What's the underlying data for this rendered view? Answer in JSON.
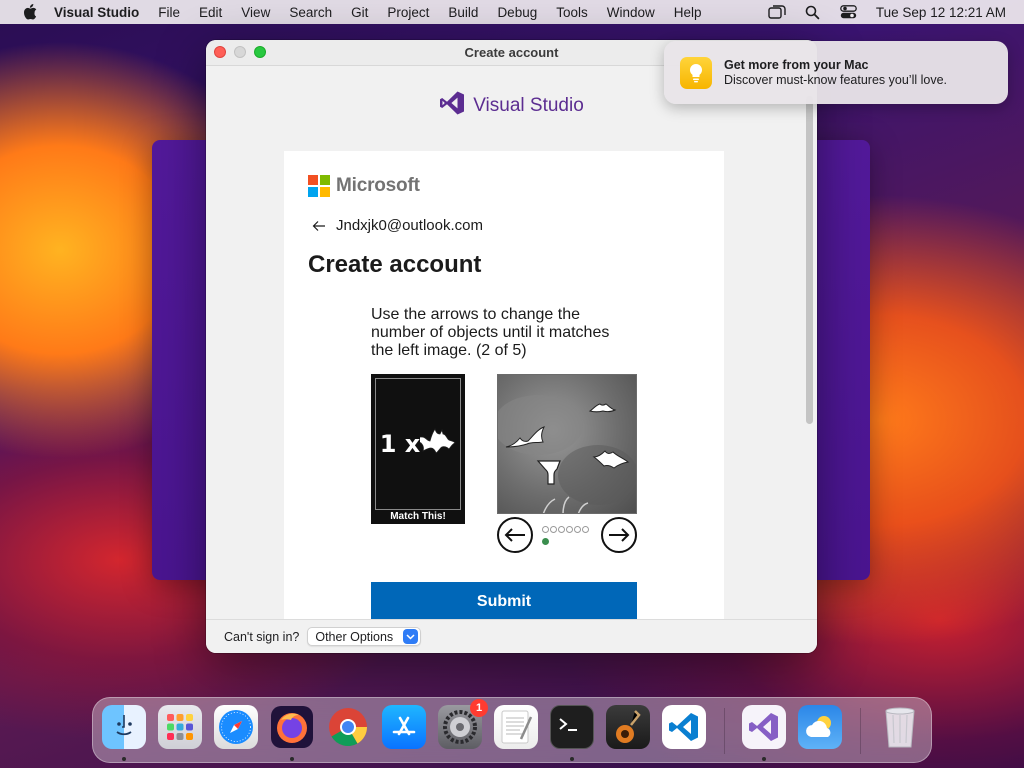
{
  "menubar": {
    "app_name": "Visual Studio",
    "items": [
      "File",
      "Edit",
      "View",
      "Search",
      "Git",
      "Project",
      "Build",
      "Debug",
      "Tools",
      "Window",
      "Help"
    ],
    "clock": "Tue Sep 12  12:21 AM",
    "status_icons": [
      "window-switcher-icon",
      "spotlight-search-icon",
      "control-center-icon"
    ]
  },
  "dialog": {
    "title": "Create account",
    "brand": "Visual Studio"
  },
  "signin": {
    "provider": "Microsoft",
    "email": "Jndxjk0@outlook.com",
    "heading": "Create account",
    "instructions": "Use the arrows to change the number of objects until it matches the left image. (2 of 5)",
    "target_count": "1 x",
    "target_caption": "Match This!",
    "selected_option": 1,
    "total_options": 6,
    "submit_label": "Submit"
  },
  "footer": {
    "cant_sign_in": "Can't sign in?",
    "options_label": "Other Options"
  },
  "notification": {
    "title": "Get more from your Mac",
    "subtitle": "Discover must-know features you’ll love."
  },
  "dock": {
    "items": [
      {
        "name": "finder",
        "running": true
      },
      {
        "name": "launchpad",
        "running": false
      },
      {
        "name": "safari",
        "running": false
      },
      {
        "name": "firefox",
        "running": true
      },
      {
        "name": "chrome",
        "running": false
      },
      {
        "name": "app-store",
        "running": false
      },
      {
        "name": "system-settings",
        "running": false,
        "badge": "1"
      },
      {
        "name": "textedit",
        "running": false
      },
      {
        "name": "terminal",
        "running": true
      },
      {
        "name": "garageband",
        "running": false
      },
      {
        "name": "vscode",
        "running": false
      },
      {
        "name": "visual-studio",
        "running": true
      },
      {
        "name": "weather",
        "running": false
      },
      {
        "name": "trash",
        "running": false
      }
    ]
  },
  "colors": {
    "ms_blue": "#0067b8",
    "vs_purple": "#5c2d91",
    "accent_green": "#3a8e4e"
  }
}
